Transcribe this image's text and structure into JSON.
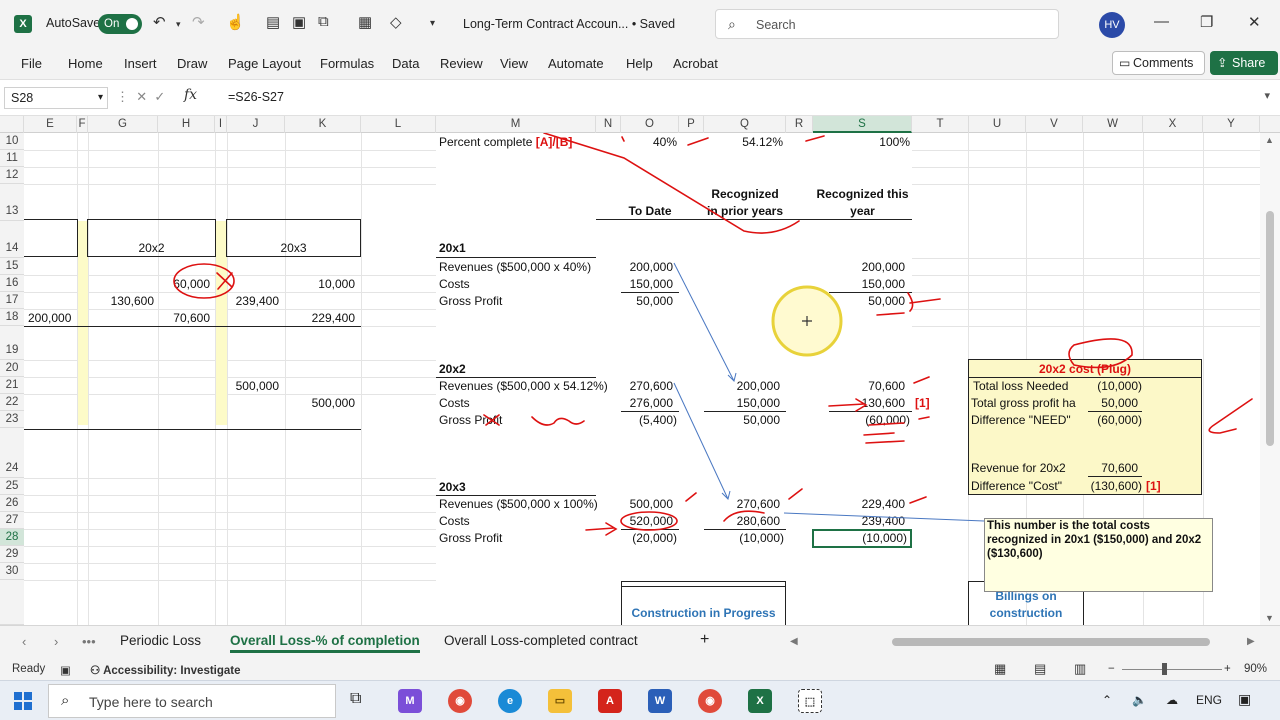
{
  "titlebar": {
    "autosave_label": "AutoSave",
    "autosave_state": "On",
    "doc_title": "Long-Term Contract Accoun... • Saved",
    "search_placeholder": "Search",
    "user_initials": "HV"
  },
  "ribbon": {
    "tabs": [
      "File",
      "Home",
      "Insert",
      "Draw",
      "Page Layout",
      "Formulas",
      "Data",
      "Review",
      "View",
      "Automate",
      "Help",
      "Acrobat"
    ],
    "comments_label": "Comments",
    "share_label": "Share"
  },
  "formula_bar": {
    "name_box": "S28",
    "formula": "=S26-S27"
  },
  "columns": [
    "E",
    "F",
    "G",
    "H",
    "I",
    "J",
    "K",
    "L",
    "M",
    "N",
    "O",
    "P",
    "Q",
    "R",
    "S",
    "T",
    "U",
    "V",
    "W",
    "X",
    "Y"
  ],
  "rows": [
    "10",
    "11",
    "12",
    "13",
    "14",
    "15",
    "16",
    "17",
    "18",
    "19",
    "20",
    "21",
    "22",
    "23",
    "24",
    "25",
    "26",
    "27",
    "28",
    "29",
    "30"
  ],
  "left_block": {
    "header_20x2": "20x2",
    "header_20x3": "20x3",
    "h16": "60,000",
    "k16": "10,000",
    "g17": "130,600",
    "j17": "239,400",
    "e18": "200,000",
    "h18": "70,600",
    "k18": "229,400",
    "j21": "500,000",
    "k22": "500,000"
  },
  "main": {
    "percent_label": "Percent complete",
    "percent_ref": "[A]/[B]",
    "pct_to_date": "40%",
    "pct_prior": "54.12%",
    "pct_this": "100%",
    "hdr_to_date": "To Date",
    "hdr_prior_1": "Recognized",
    "hdr_prior_2": "in prior years",
    "hdr_this_1": "Recognized this",
    "hdr_this_2": "year",
    "y1": {
      "label": "20x1",
      "rev_label": "Revenues ($500,000 x 40%)",
      "cost_label": "Costs",
      "gp_label": "Gross Profit",
      "rev_to_date": "200,000",
      "cost_to_date": "150,000",
      "gp_to_date": "50,000",
      "rev_this": "200,000",
      "cost_this": "150,000",
      "gp_this": "50,000"
    },
    "y2": {
      "label": "20x2",
      "rev_label": "Revenues ($500,000 x 54.12%)",
      "cost_label": "Costs",
      "gp_label": "Gross Profit",
      "rev_to_date": "270,600",
      "cost_to_date": "276,000",
      "gp_to_date": "(5,400)",
      "rev_prior": "200,000",
      "cost_prior": "150,000",
      "gp_prior": "50,000",
      "rev_this": "70,600",
      "cost_this": "130,600",
      "cost_ref": "[1]",
      "gp_this": "(60,000)"
    },
    "y3": {
      "label": "20x3",
      "rev_label": "Revenues ($500,000 x 100%)",
      "cost_label": "Costs",
      "gp_label": "Gross Profit",
      "rev_to_date": "500,000",
      "cost_to_date": "520,000",
      "gp_to_date": "(20,000)",
      "rev_prior": "270,600",
      "cost_prior": "280,600",
      "gp_prior": "(10,000)",
      "rev_this": "229,400",
      "cost_this": "239,400",
      "gp_this": "(10,000)"
    },
    "cip_label": "Construction in Progress",
    "billings_label_1": "Billings on",
    "billings_label_2": "construction"
  },
  "plug_box": {
    "title": "20x2 cost (Plug)",
    "rows": [
      {
        "label": "Total loss Needed",
        "value": "(10,000)"
      },
      {
        "label": "Total gross profit ha",
        "value": "50,000"
      },
      {
        "label": "Difference \"NEED\"",
        "value": "(60,000)"
      }
    ],
    "rev_label": "Revenue for 20x2",
    "rev_value": "70,600",
    "diff_label": "Difference \"Cost\"",
    "diff_value": "(130,600)",
    "diff_ref": "[1]"
  },
  "note": "This number is the total costs recognized in 20x1 ($150,000) and 20x2 ($130,600)",
  "sheets": [
    "Periodic Loss",
    "Overall Loss-% of completion",
    "Overall Loss-completed contract"
  ],
  "status": {
    "ready": "Ready",
    "accessibility": "Accessibility: Investigate",
    "zoom": "90%"
  },
  "taskbar": {
    "search_placeholder": "Type here to search",
    "lang": "ENG"
  },
  "colors": {
    "excel_green": "#1e7145",
    "annotation_red": "#d11",
    "link_blue": "#2e74b5",
    "plug_box_fill": "#fcf8c8"
  }
}
